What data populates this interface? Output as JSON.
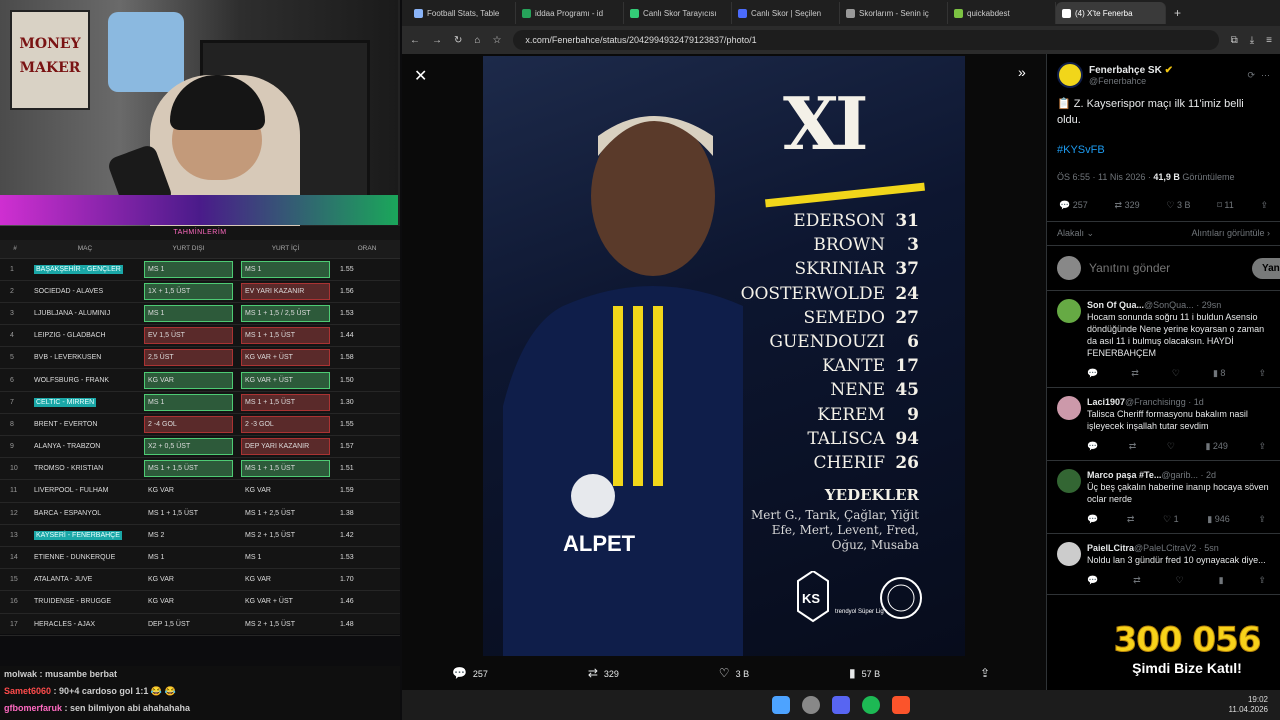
{
  "stream": {
    "panel_title": "TAHMİNLERİM",
    "columns": [
      "#",
      "MAÇ",
      "YURT DIŞI",
      "YURT İÇİ",
      "ORAN"
    ],
    "rows": [
      {
        "n": "1",
        "match": "BAŞAKŞEHİR - GENÇLER",
        "hl": true,
        "a": "MS 1",
        "as": "g",
        "b": "MS 1",
        "bs": "g",
        "odd": "1.55"
      },
      {
        "n": "2",
        "match": "SOCIEDAD - ALAVES",
        "hl": false,
        "a": "1X + 1,5 ÜST",
        "as": "g",
        "b": "EV YARI KAZANIR",
        "bs": "r",
        "odd": "1.56"
      },
      {
        "n": "3",
        "match": "LJUBLJANA - ALUMINIJ",
        "hl": false,
        "a": "MS 1",
        "as": "g",
        "b": "MS 1 + 1,5 / 2,5 ÜST",
        "bs": "g",
        "odd": "1.53"
      },
      {
        "n": "4",
        "match": "LEIPZIG - GLADBACH",
        "hl": false,
        "a": "EV 1,5 ÜST",
        "as": "r",
        "b": "MS 1 + 1,5 ÜST",
        "bs": "r",
        "odd": "1.44"
      },
      {
        "n": "5",
        "match": "BVB - LEVERKUSEN",
        "hl": false,
        "a": "2,5 ÜST",
        "as": "r",
        "b": "KG VAR + ÜST",
        "bs": "r",
        "odd": "1.58"
      },
      {
        "n": "6",
        "match": "WOLFSBURG - FRANK",
        "hl": false,
        "a": "KG VAR",
        "as": "g",
        "b": "KG VAR + ÜST",
        "bs": "g",
        "odd": "1.50"
      },
      {
        "n": "7",
        "match": "CELTIC - MIRREN",
        "hl": true,
        "a": "MS 1",
        "as": "g",
        "b": "MS 1 + 1,5 ÜST",
        "bs": "r",
        "odd": "1.30"
      },
      {
        "n": "8",
        "match": "BRENT - EVERTON",
        "hl": false,
        "a": "2 -4 GOL",
        "as": "r",
        "b": "2 -3 GOL",
        "bs": "r",
        "odd": "1.55"
      },
      {
        "n": "9",
        "match": "ALANYA - TRABZON",
        "hl": false,
        "a": "X2 + 0,5 ÜST",
        "as": "g",
        "b": "DEP YARI KAZANIR",
        "bs": "r",
        "odd": "1.57"
      },
      {
        "n": "10",
        "match": "TROMSO - KRISTIAN",
        "hl": false,
        "a": "MS 1 + 1,5 ÜST",
        "as": "g",
        "b": "MS 1 + 1,5 ÜST",
        "bs": "g",
        "odd": "1.51"
      },
      {
        "n": "11",
        "match": "LIVERPOOL - FULHAM",
        "hl": false,
        "a": "KG VAR",
        "as": "",
        "b": "KG VAR",
        "bs": "",
        "odd": "1.59"
      },
      {
        "n": "12",
        "match": "BARCA - ESPANYOL",
        "hl": false,
        "a": "MS 1 + 1,5 ÜST",
        "as": "",
        "b": "MS 1 + 2,5 ÜST",
        "bs": "",
        "odd": "1.38"
      },
      {
        "n": "13",
        "match": "KAYSERİ - FENERBAHÇE",
        "hl": true,
        "a": "MS 2",
        "as": "",
        "b": "MS 2 + 1,5 ÜST",
        "bs": "",
        "odd": "1.42"
      },
      {
        "n": "14",
        "match": "ETIENNE - DUNKERQUE",
        "hl": false,
        "a": "MS 1",
        "as": "",
        "b": "MS 1",
        "bs": "",
        "odd": "1.53"
      },
      {
        "n": "15",
        "match": "ATALANTA - JUVE",
        "hl": false,
        "a": "KG VAR",
        "as": "",
        "b": "KG VAR",
        "bs": "",
        "odd": "1.70"
      },
      {
        "n": "16",
        "match": "TRUIDENSE - BRUGGE",
        "hl": false,
        "a": "KG VAR",
        "as": "",
        "b": "KG VAR + ÜST",
        "bs": "",
        "odd": "1.46"
      },
      {
        "n": "17",
        "match": "HERACLES - AJAX",
        "hl": false,
        "a": "DEP 1,5 ÜST",
        "as": "",
        "b": "MS 2 + 1,5 ÜST",
        "bs": "",
        "odd": "1.48"
      }
    ],
    "chat": [
      {
        "user": "molwak",
        "text": "musambe berbat",
        "cls": "u1"
      },
      {
        "user": "Samet6060",
        "text": "90+4 cardoso gol 1:1 😂 😂",
        "cls": "u2"
      },
      {
        "user": "gfbomerfaruk",
        "text": "sen bilmiyon abi ahahahaha",
        "cls": "u3"
      }
    ],
    "webcam_poster": "MONEY MAKER",
    "overlay_count": "300 056",
    "overlay_cta": "Şimdi Bize Katıl!"
  },
  "browser": {
    "tabs": [
      {
        "label": "Football Stats, Table",
        "color": "#8ab4f8"
      },
      {
        "label": "iddaa Programı - id",
        "color": "#26a35a"
      },
      {
        "label": "Canlı Skor Tarayıcısı",
        "color": "#3c7"
      },
      {
        "label": "Canlı Skor | Seçilen",
        "color": "#4b6bfb"
      },
      {
        "label": "Skorlarım - Senin iç",
        "color": "#999"
      },
      {
        "label": "quickabdest",
        "color": "#7cc242"
      },
      {
        "label": "(4) X'te Fenerba",
        "color": "#fff"
      }
    ],
    "url": "x.com/Fenerbahce/status/2042994932479123837/photo/1"
  },
  "poster": {
    "title": "XI",
    "lineup": [
      {
        "name": "EDERSON",
        "num": "31"
      },
      {
        "name": "BROWN",
        "num": "3"
      },
      {
        "name": "SKRINIAR",
        "num": "37"
      },
      {
        "name": "OOSTERWOLDE",
        "num": "24"
      },
      {
        "name": "SEMEDO",
        "num": "27"
      },
      {
        "name": "GUENDOUZI",
        "num": "6"
      },
      {
        "name": "KANTE",
        "num": "17"
      },
      {
        "name": "NENE",
        "num": "45"
      },
      {
        "name": "KEREM",
        "num": "9"
      },
      {
        "name": "TALISCA",
        "num": "94"
      },
      {
        "name": "CHERIF",
        "num": "26"
      }
    ],
    "subs_title": "YEDEKLER",
    "subs": "Mert G., Tarık, Çağlar, Yiğit Efe, Mert, Levent, Fred, Oğuz, Musaba",
    "sponsor": "ALPET",
    "club_short": "KS",
    "league": "trendyol Süper Lig"
  },
  "photo_stats": {
    "replies": "257",
    "reposts": "329",
    "likes": "3 B",
    "views": "57 B"
  },
  "tweet": {
    "author": "Fenerbahçe SK",
    "handle": "@Fenerbahce",
    "text": "📋 Z. Kayserispor maçı ilk 11'imiz belli oldu.",
    "hashtag": "#KYSvFB",
    "time": "ÖS 6:55 · 11 Nis 2026 · ",
    "views_num": "41,9 B",
    "views_label": " Görüntüleme",
    "stats": {
      "replies": "257",
      "reposts": "329",
      "likes": "3 B",
      "bookmarks": "11"
    },
    "sort": "Alakalı",
    "quotes": "Alıntıları görüntüle",
    "reply_placeholder": "Yanıtını gönder",
    "reply_button": "Yanıtla"
  },
  "replies": [
    {
      "name": "Son Of Qua...",
      "handle": "@SonQua...",
      "ago": "29sn",
      "text": "Hocam sonunda soğru 11 i buldun Asensio döndüğünde Nene yerine koyarsan o zaman da asıl 11 i bulmuş olacaksın. HAYDİ FENERBAHÇEM",
      "views": "8",
      "color": "#6a4"
    },
    {
      "name": "Laci1907",
      "handle": "@Franchisingg",
      "ago": "1d",
      "text": "Talisca Cheriff formasyonu bakalım nasil işleyecek inşallah tutar sevdim",
      "views": "249",
      "color": "#c9a"
    },
    {
      "name": "Marco paşa #Te...",
      "handle": "@garib...",
      "ago": "2d",
      "text": "Üç beş çakalın haberine inanıp hocaya söven oclar nerde",
      "views": "946",
      "likes": "1",
      "color": "#363"
    },
    {
      "name": "PaielLCitra",
      "handle": "@PaleLCitraV2",
      "ago": "5sn",
      "text": "Noldu lan 3 gündür fred 10 oynayacak diye...",
      "views": "",
      "color": "#ccc"
    }
  ],
  "clock": {
    "time": "19:02",
    "date": "11.04.2026"
  }
}
